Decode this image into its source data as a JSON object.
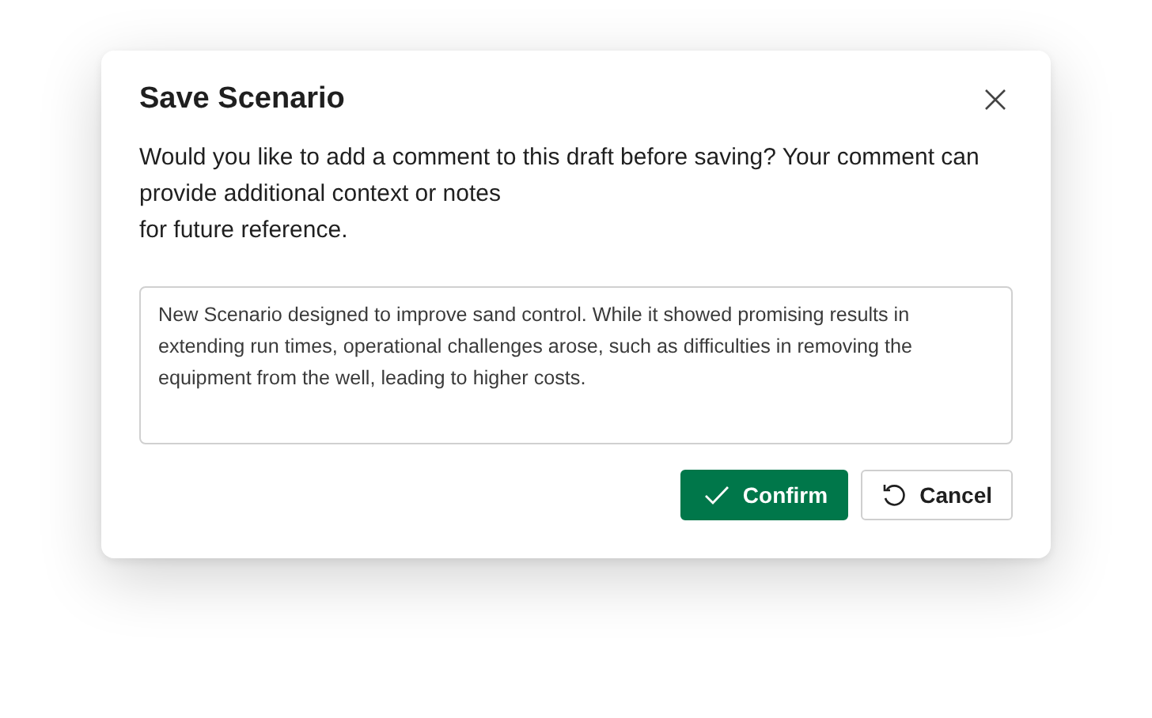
{
  "dialog": {
    "title": "Save Scenario",
    "message_lines": [
      "Would you like to add a comment to this draft before saving? Your comment can provide additional context or notes",
      "for future reference."
    ],
    "comment": {
      "value": "New Scenario designed to improve sand control. While it showed promising results in extending run times, operational challenges arose, such as difficulties in removing the equipment from the well, leading to higher costs."
    },
    "buttons": [
      {
        "kind": "confirm",
        "label": "Confirm"
      },
      {
        "kind": "cancel",
        "label": "Cancel"
      }
    ]
  }
}
